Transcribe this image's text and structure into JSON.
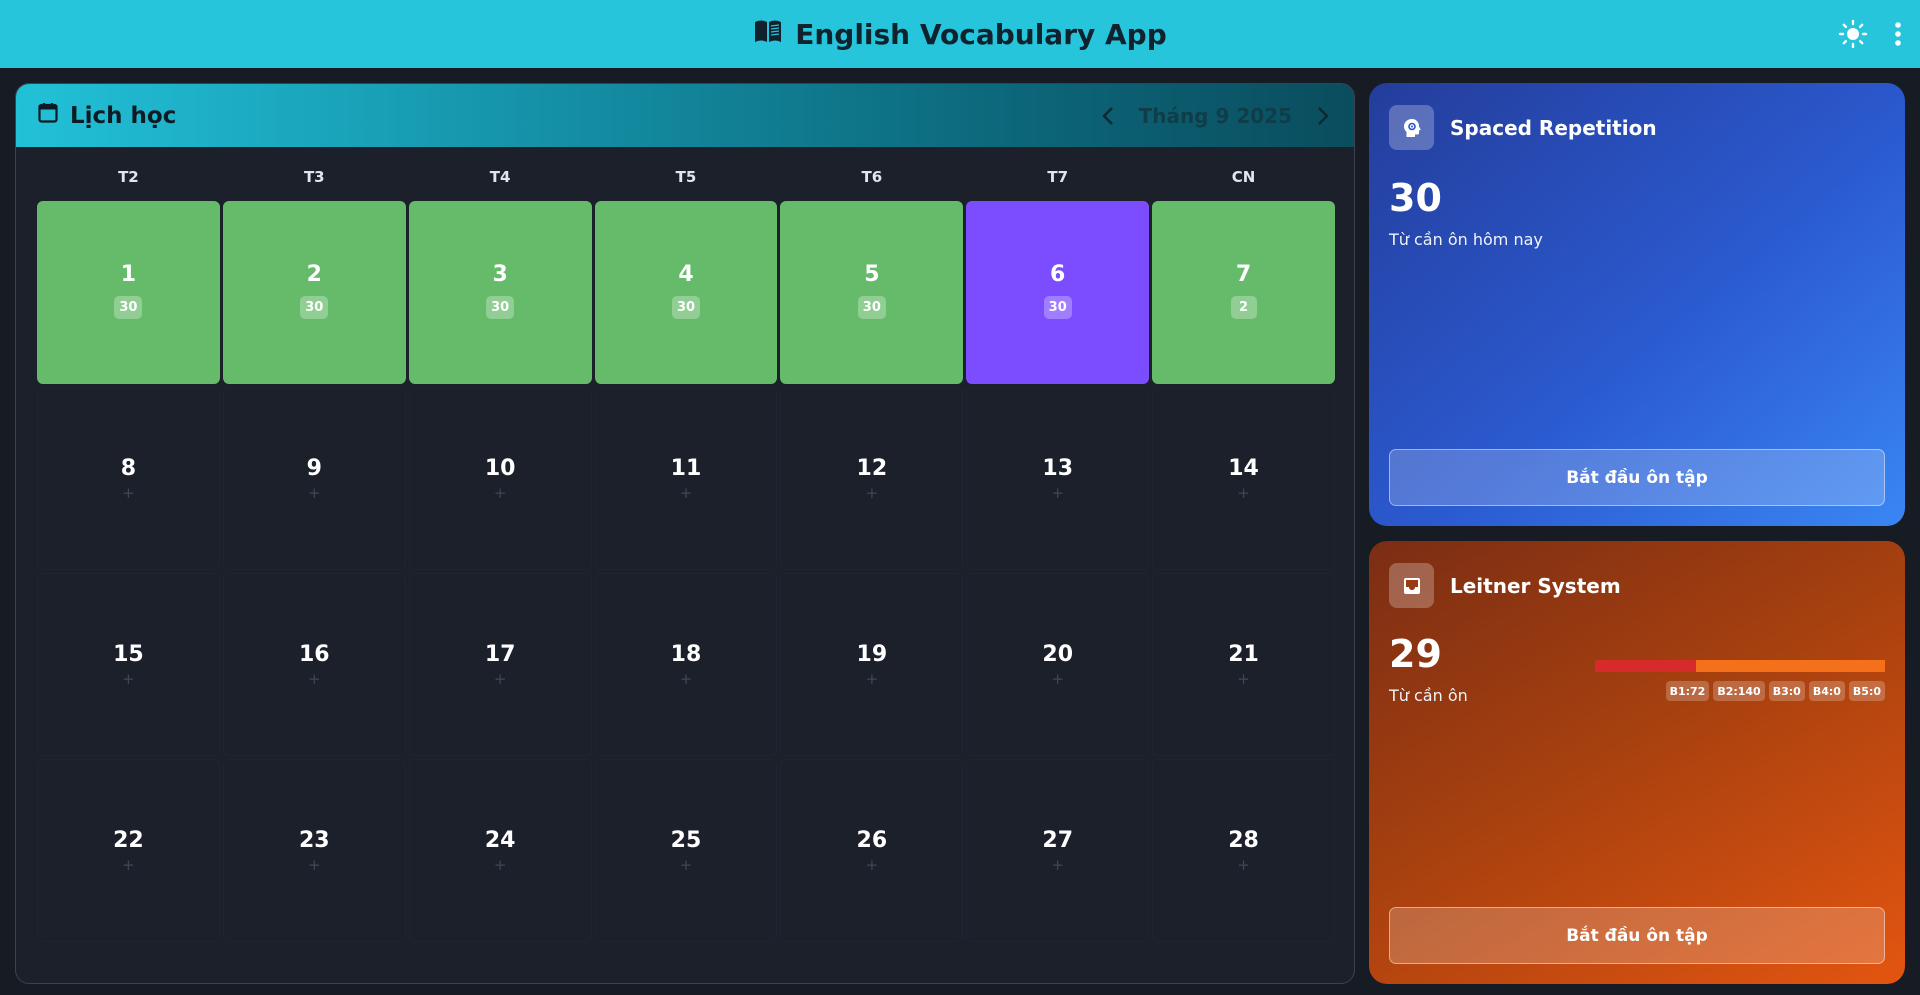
{
  "header": {
    "title": "English Vocabulary App",
    "icons": [
      "book-icon",
      "sun-icon",
      "more-vert-icon"
    ],
    "color": "#26c5db"
  },
  "calendar": {
    "title": "Lịch học",
    "month_label": "Tháng 9 2025",
    "weekdays": [
      "T2",
      "T3",
      "T4",
      "T5",
      "T6",
      "T7",
      "CN"
    ],
    "days": [
      {
        "num": "1",
        "count": "30",
        "status": "done"
      },
      {
        "num": "2",
        "count": "30",
        "status": "done"
      },
      {
        "num": "3",
        "count": "30",
        "status": "done"
      },
      {
        "num": "4",
        "count": "30",
        "status": "done"
      },
      {
        "num": "5",
        "count": "30",
        "status": "done"
      },
      {
        "num": "6",
        "count": "30",
        "status": "today"
      },
      {
        "num": "7",
        "count": "2",
        "status": "done"
      },
      {
        "num": "8",
        "plus": "+"
      },
      {
        "num": "9",
        "plus": "+"
      },
      {
        "num": "10",
        "plus": "+"
      },
      {
        "num": "11",
        "plus": "+"
      },
      {
        "num": "12",
        "plus": "+"
      },
      {
        "num": "13",
        "plus": "+"
      },
      {
        "num": "14",
        "plus": "+"
      },
      {
        "num": "15",
        "plus": "+"
      },
      {
        "num": "16",
        "plus": "+"
      },
      {
        "num": "17",
        "plus": "+"
      },
      {
        "num": "18",
        "plus": "+"
      },
      {
        "num": "19",
        "plus": "+"
      },
      {
        "num": "20",
        "plus": "+"
      },
      {
        "num": "21",
        "plus": "+"
      },
      {
        "num": "22",
        "plus": "+"
      },
      {
        "num": "23",
        "plus": "+"
      },
      {
        "num": "24",
        "plus": "+"
      },
      {
        "num": "25",
        "plus": "+"
      },
      {
        "num": "26",
        "plus": "+"
      },
      {
        "num": "27",
        "plus": "+"
      },
      {
        "num": "28",
        "plus": "+"
      }
    ],
    "colors": {
      "done": "#66bb6a",
      "today": "#7c4dff"
    }
  },
  "spaced_repetition": {
    "title": "Spaced Repetition",
    "count": "30",
    "subtitle": "Từ cần ôn hôm nay",
    "button": "Bắt đầu ôn tập",
    "icon": "brain-icon"
  },
  "leitner": {
    "title": "Leitner System",
    "count": "29",
    "subtitle": "Từ cần ôn",
    "button": "Bắt đầu ôn tập",
    "icon": "inbox-icon",
    "boxes": [
      "B1:72",
      "B2:140",
      "B3:0",
      "B4:0",
      "B5:0"
    ],
    "box_values": [
      72,
      140,
      0,
      0,
      0
    ],
    "bar_colors": [
      "#d72b2b",
      "#f4701a"
    ]
  }
}
